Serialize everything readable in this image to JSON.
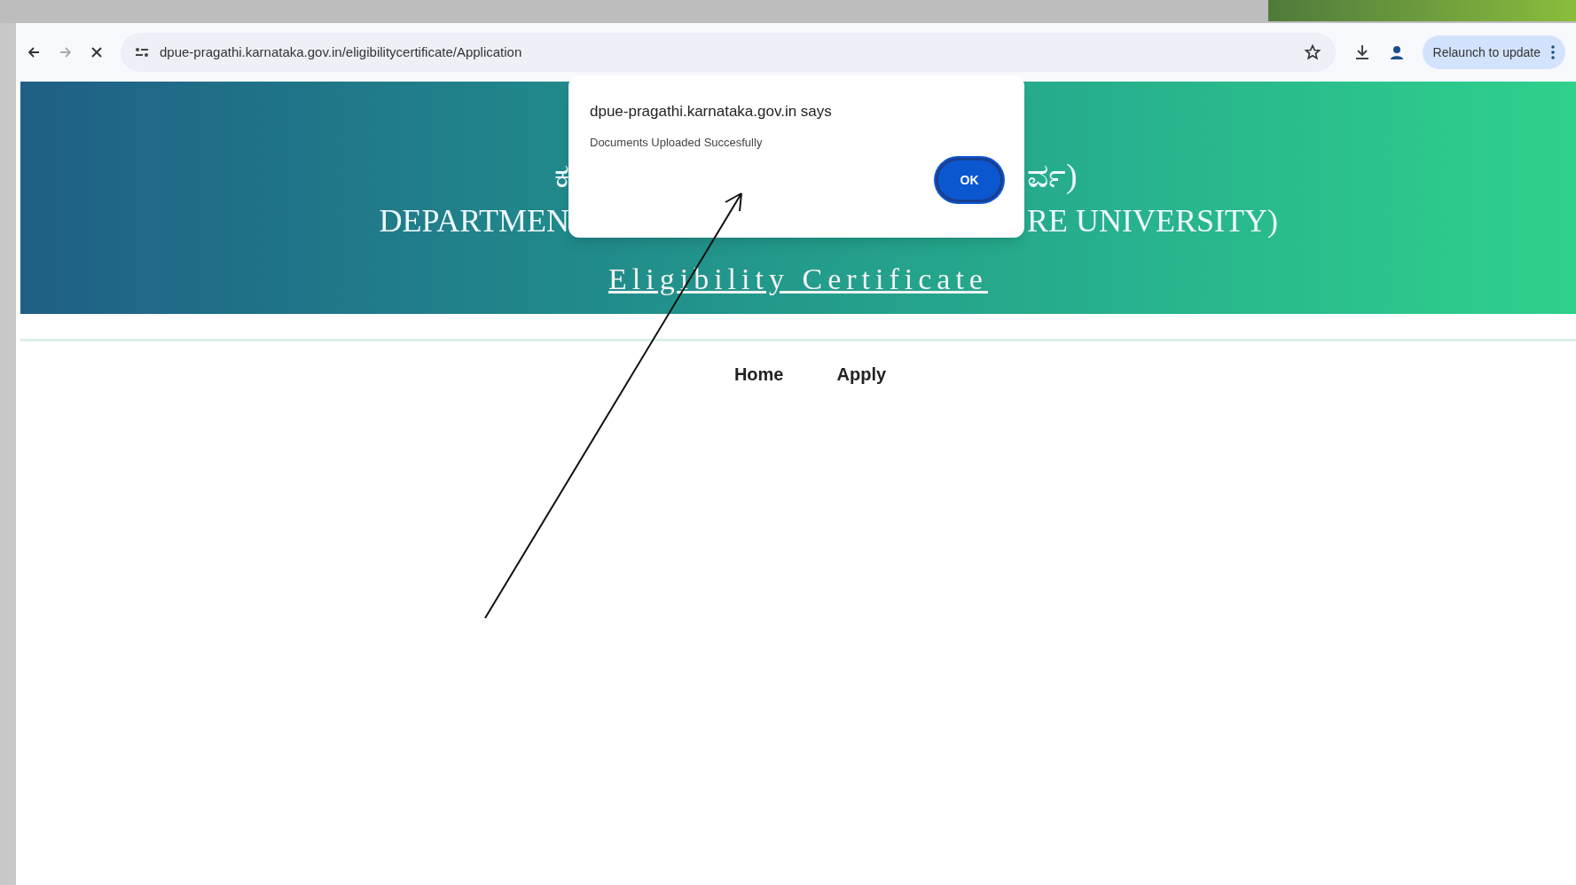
{
  "browser": {
    "url": "dpue-pragathi.karnataka.gov.in/eligibilitycertificate/Application",
    "update_button": "Relaunch to update"
  },
  "banner": {
    "line_1_left": "ಕ",
    "line_1_right": "ರ್ವ)",
    "line_2_left": "DEPARTMEN",
    "line_2_right": "RE UNIVERSITY)",
    "title": "Eligibility Certificate"
  },
  "nav": [
    {
      "label": "Home"
    },
    {
      "label": "Apply"
    }
  ],
  "dialog": {
    "title": "dpue-pragathi.karnataka.gov.in says",
    "message": "Documents Uploaded Succesfully",
    "button": "OK"
  }
}
